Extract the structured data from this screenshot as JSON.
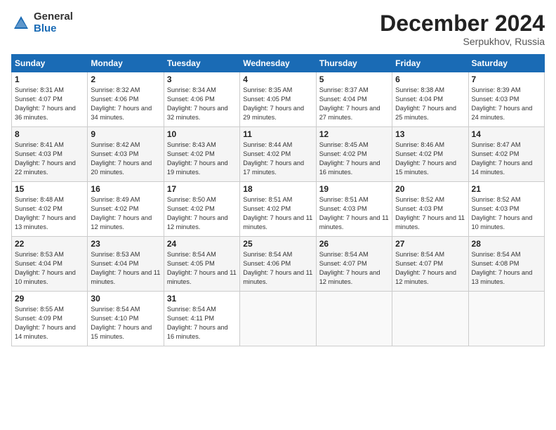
{
  "logo": {
    "general": "General",
    "blue": "Blue"
  },
  "title": "December 2024",
  "location": "Serpukhov, Russia",
  "headers": [
    "Sunday",
    "Monday",
    "Tuesday",
    "Wednesday",
    "Thursday",
    "Friday",
    "Saturday"
  ],
  "weeks": [
    [
      {
        "day": "1",
        "sunrise": "8:31 AM",
        "sunset": "4:07 PM",
        "daylight": "7 hours and 36 minutes."
      },
      {
        "day": "2",
        "sunrise": "8:32 AM",
        "sunset": "4:06 PM",
        "daylight": "7 hours and 34 minutes."
      },
      {
        "day": "3",
        "sunrise": "8:34 AM",
        "sunset": "4:06 PM",
        "daylight": "7 hours and 32 minutes."
      },
      {
        "day": "4",
        "sunrise": "8:35 AM",
        "sunset": "4:05 PM",
        "daylight": "7 hours and 29 minutes."
      },
      {
        "day": "5",
        "sunrise": "8:37 AM",
        "sunset": "4:04 PM",
        "daylight": "7 hours and 27 minutes."
      },
      {
        "day": "6",
        "sunrise": "8:38 AM",
        "sunset": "4:04 PM",
        "daylight": "7 hours and 25 minutes."
      },
      {
        "day": "7",
        "sunrise": "8:39 AM",
        "sunset": "4:03 PM",
        "daylight": "7 hours and 24 minutes."
      }
    ],
    [
      {
        "day": "8",
        "sunrise": "8:41 AM",
        "sunset": "4:03 PM",
        "daylight": "7 hours and 22 minutes."
      },
      {
        "day": "9",
        "sunrise": "8:42 AM",
        "sunset": "4:03 PM",
        "daylight": "7 hours and 20 minutes."
      },
      {
        "day": "10",
        "sunrise": "8:43 AM",
        "sunset": "4:02 PM",
        "daylight": "7 hours and 19 minutes."
      },
      {
        "day": "11",
        "sunrise": "8:44 AM",
        "sunset": "4:02 PM",
        "daylight": "7 hours and 17 minutes."
      },
      {
        "day": "12",
        "sunrise": "8:45 AM",
        "sunset": "4:02 PM",
        "daylight": "7 hours and 16 minutes."
      },
      {
        "day": "13",
        "sunrise": "8:46 AM",
        "sunset": "4:02 PM",
        "daylight": "7 hours and 15 minutes."
      },
      {
        "day": "14",
        "sunrise": "8:47 AM",
        "sunset": "4:02 PM",
        "daylight": "7 hours and 14 minutes."
      }
    ],
    [
      {
        "day": "15",
        "sunrise": "8:48 AM",
        "sunset": "4:02 PM",
        "daylight": "7 hours and 13 minutes."
      },
      {
        "day": "16",
        "sunrise": "8:49 AM",
        "sunset": "4:02 PM",
        "daylight": "7 hours and 12 minutes."
      },
      {
        "day": "17",
        "sunrise": "8:50 AM",
        "sunset": "4:02 PM",
        "daylight": "7 hours and 12 minutes."
      },
      {
        "day": "18",
        "sunrise": "8:51 AM",
        "sunset": "4:02 PM",
        "daylight": "7 hours and 11 minutes."
      },
      {
        "day": "19",
        "sunrise": "8:51 AM",
        "sunset": "4:03 PM",
        "daylight": "7 hours and 11 minutes."
      },
      {
        "day": "20",
        "sunrise": "8:52 AM",
        "sunset": "4:03 PM",
        "daylight": "7 hours and 11 minutes."
      },
      {
        "day": "21",
        "sunrise": "8:52 AM",
        "sunset": "4:03 PM",
        "daylight": "7 hours and 10 minutes."
      }
    ],
    [
      {
        "day": "22",
        "sunrise": "8:53 AM",
        "sunset": "4:04 PM",
        "daylight": "7 hours and 10 minutes."
      },
      {
        "day": "23",
        "sunrise": "8:53 AM",
        "sunset": "4:04 PM",
        "daylight": "7 hours and 11 minutes."
      },
      {
        "day": "24",
        "sunrise": "8:54 AM",
        "sunset": "4:05 PM",
        "daylight": "7 hours and 11 minutes."
      },
      {
        "day": "25",
        "sunrise": "8:54 AM",
        "sunset": "4:06 PM",
        "daylight": "7 hours and 11 minutes."
      },
      {
        "day": "26",
        "sunrise": "8:54 AM",
        "sunset": "4:07 PM",
        "daylight": "7 hours and 12 minutes."
      },
      {
        "day": "27",
        "sunrise": "8:54 AM",
        "sunset": "4:07 PM",
        "daylight": "7 hours and 12 minutes."
      },
      {
        "day": "28",
        "sunrise": "8:54 AM",
        "sunset": "4:08 PM",
        "daylight": "7 hours and 13 minutes."
      }
    ],
    [
      {
        "day": "29",
        "sunrise": "8:55 AM",
        "sunset": "4:09 PM",
        "daylight": "7 hours and 14 minutes."
      },
      {
        "day": "30",
        "sunrise": "8:54 AM",
        "sunset": "4:10 PM",
        "daylight": "7 hours and 15 minutes."
      },
      {
        "day": "31",
        "sunrise": "8:54 AM",
        "sunset": "4:11 PM",
        "daylight": "7 hours and 16 minutes."
      },
      null,
      null,
      null,
      null
    ]
  ]
}
